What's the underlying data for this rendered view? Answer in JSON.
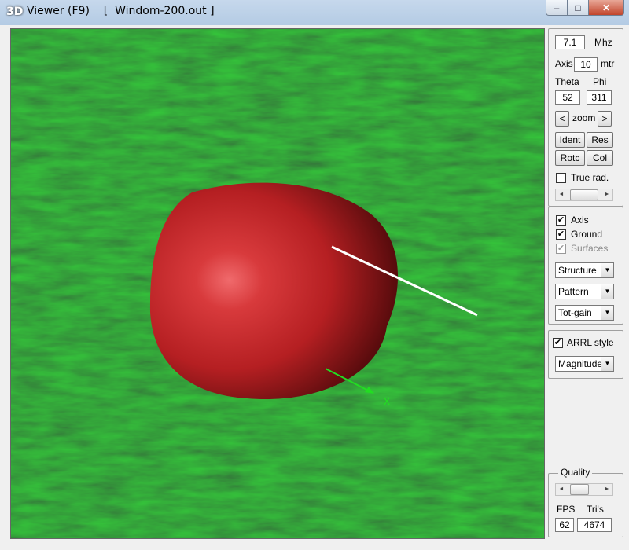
{
  "window": {
    "title_prefix": "3D",
    "title": "Viewer (F9)    [  Windom-200.out ]",
    "minimize": "–",
    "maximize": "□",
    "close": "✕"
  },
  "panel": {
    "frequency": {
      "value": "7.1",
      "unit": "Mhz"
    },
    "axis": {
      "label": "Axis",
      "value": "10",
      "unit": "mtr"
    },
    "theta": {
      "label": "Theta",
      "value": "52"
    },
    "phi": {
      "label": "Phi",
      "value": "311"
    },
    "zoom": {
      "left": "<",
      "label": "zoom",
      "right": ">"
    },
    "buttons": {
      "ident": "Ident",
      "res": "Res",
      "rotc": "Rotc",
      "col": "Col"
    },
    "true_rad": {
      "label": "True rad.",
      "checked": false
    },
    "axis_check": {
      "label": "Axis",
      "mark": "✔"
    },
    "ground_check": {
      "label": "Ground",
      "mark": "✔"
    },
    "surfaces_check": {
      "label": "Surfaces",
      "mark": "✔"
    },
    "combos": {
      "structure": "Structure",
      "pattern": "Pattern",
      "gain": "Tot-gain"
    },
    "arrl": {
      "label": "ARRL style",
      "mark": "✔",
      "combo": "Magnitude"
    },
    "quality": {
      "label": "Quality"
    },
    "stats": {
      "fps_label": "FPS",
      "fps": "62",
      "tris_label": "Tri's",
      "tris": "4674"
    }
  },
  "icons": {
    "arrow_left": "◄",
    "arrow_right": "►",
    "arrow_down": "▼"
  },
  "scene": {
    "ground_color": "#1f5a22",
    "lobe_color": "#b51f22",
    "axis_line_color": "#ffffff",
    "x_axis_color": "#22dd22",
    "x_axis_label": "x"
  }
}
